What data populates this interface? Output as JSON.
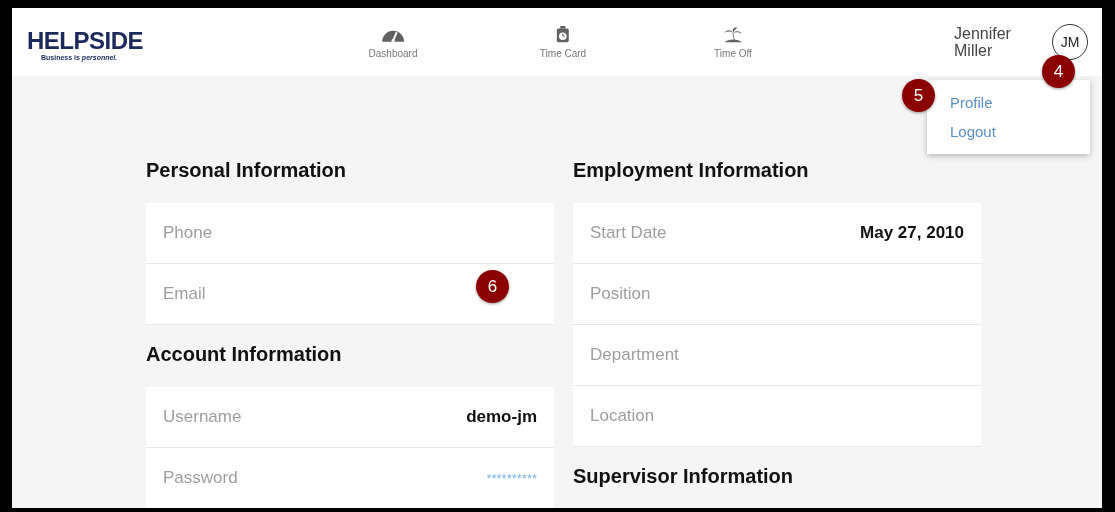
{
  "logo": {
    "name": "HELPSIDE",
    "tagline": "Business is *personnel.*"
  },
  "nav": [
    {
      "label": "Dashboard",
      "kind": "gauge"
    },
    {
      "label": "Time Card",
      "kind": "timer"
    },
    {
      "label": "Time Off",
      "kind": "island"
    }
  ],
  "user": {
    "name": "Jennifer Miller",
    "initials": "JM"
  },
  "user_menu": [
    {
      "label": "Profile"
    },
    {
      "label": "Logout"
    }
  ],
  "left_column": [
    {
      "title": "Personal Information",
      "rows": [
        {
          "label": "Phone"
        },
        {
          "label": "Email"
        }
      ]
    },
    {
      "title": "Account Information",
      "rows": [
        {
          "label": "Username",
          "value": "demo-jm"
        },
        {
          "label": "Password",
          "value": "**********",
          "kind": "masked"
        }
      ]
    }
  ],
  "right_column": [
    {
      "title": "Employment Information",
      "rows": [
        {
          "label": "Start Date",
          "value": "May 27, 2010"
        },
        {
          "label": "Position"
        },
        {
          "label": "Department"
        },
        {
          "label": "Location"
        }
      ]
    },
    {
      "title": "Supervisor Information"
    }
  ],
  "callouts": [
    {
      "number": "4"
    },
    {
      "number": "5"
    },
    {
      "number": "6"
    }
  ]
}
